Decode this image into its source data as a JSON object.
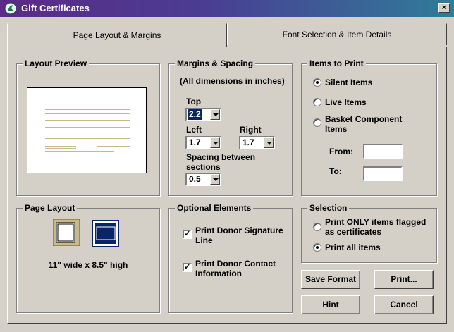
{
  "window": {
    "title": "Gift Certificates",
    "close_label": "×"
  },
  "tabs": [
    {
      "label": "Page Layout & Margins"
    },
    {
      "label": "Font Selection & Item Details"
    }
  ],
  "layout_preview": {
    "label": "Layout Preview"
  },
  "margins": {
    "label": "Margins & Spacing",
    "note": "(All dimensions in inches)",
    "top_label": "Top",
    "top_value": "2.2",
    "left_label": "Left",
    "left_value": "1.7",
    "right_label": "Right",
    "right_value": "1.7",
    "spacing_label": "Spacing between sections",
    "spacing_value": "0.5"
  },
  "items_to_print": {
    "label": "Items to Print",
    "options": [
      "Silent Items",
      "Live Items",
      "Basket Component Items"
    ],
    "from_label": "From:",
    "to_label": "To:",
    "from_value": "",
    "to_value": ""
  },
  "page_layout": {
    "label": "Page Layout",
    "size_text": "11\" wide x 8.5\" high"
  },
  "optional": {
    "label": "Optional Elements",
    "sig_label": "Print Donor Signature Line",
    "contact_label": "Print Donor Contact Information"
  },
  "selection": {
    "label": "Selection",
    "flagged_label": "Print ONLY items flagged as certificates",
    "all_label": "Print all items"
  },
  "buttons": {
    "save_format": "Save Format",
    "print": "Print...",
    "hint": "Hint",
    "cancel": "Cancel"
  }
}
